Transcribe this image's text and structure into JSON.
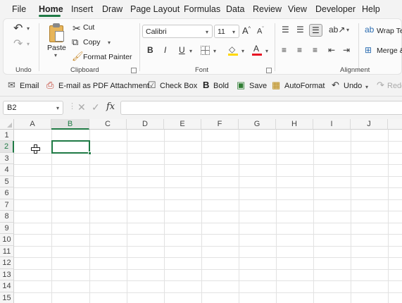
{
  "menu": {
    "tabs": [
      "File",
      "Home",
      "Insert",
      "Draw",
      "Page Layout",
      "Formulas",
      "Data",
      "Review",
      "View",
      "Developer",
      "Help"
    ],
    "active_tab": "Home"
  },
  "ribbon": {
    "undo_group": {
      "label": "Undo"
    },
    "clipboard": {
      "label": "Clipboard",
      "paste": "Paste",
      "cut": "Cut",
      "copy": "Copy",
      "format_painter": "Format Painter"
    },
    "font": {
      "label": "Font",
      "font_name": "Calibri",
      "font_size": "11",
      "bold": "B",
      "italic": "I",
      "underline": "U",
      "font_color": "#e81123",
      "fill_color": "#ffd800"
    },
    "alignment": {
      "label": "Alignment",
      "wrap_text": "Wrap Tex",
      "merge": "Merge &"
    }
  },
  "quick_access": {
    "email": "Email",
    "email_pdf": "E-mail as PDF Attachment",
    "check_box": "Check Box",
    "bold": "Bold",
    "save": "Save",
    "autoformat": "AutoFormat",
    "undo": "Undo",
    "redo": "Redo"
  },
  "formula_bar": {
    "name_box": "B2",
    "fx": "fx",
    "value": ""
  },
  "sheet": {
    "columns": [
      "A",
      "B",
      "C",
      "D",
      "E",
      "F",
      "G",
      "H",
      "I",
      "J"
    ],
    "rows": [
      "1",
      "2",
      "3",
      "4",
      "5",
      "6",
      "7",
      "8",
      "9",
      "10",
      "11",
      "12",
      "13",
      "14",
      "15"
    ],
    "active_cell": "B2",
    "accent_color": "#1f7a45"
  }
}
